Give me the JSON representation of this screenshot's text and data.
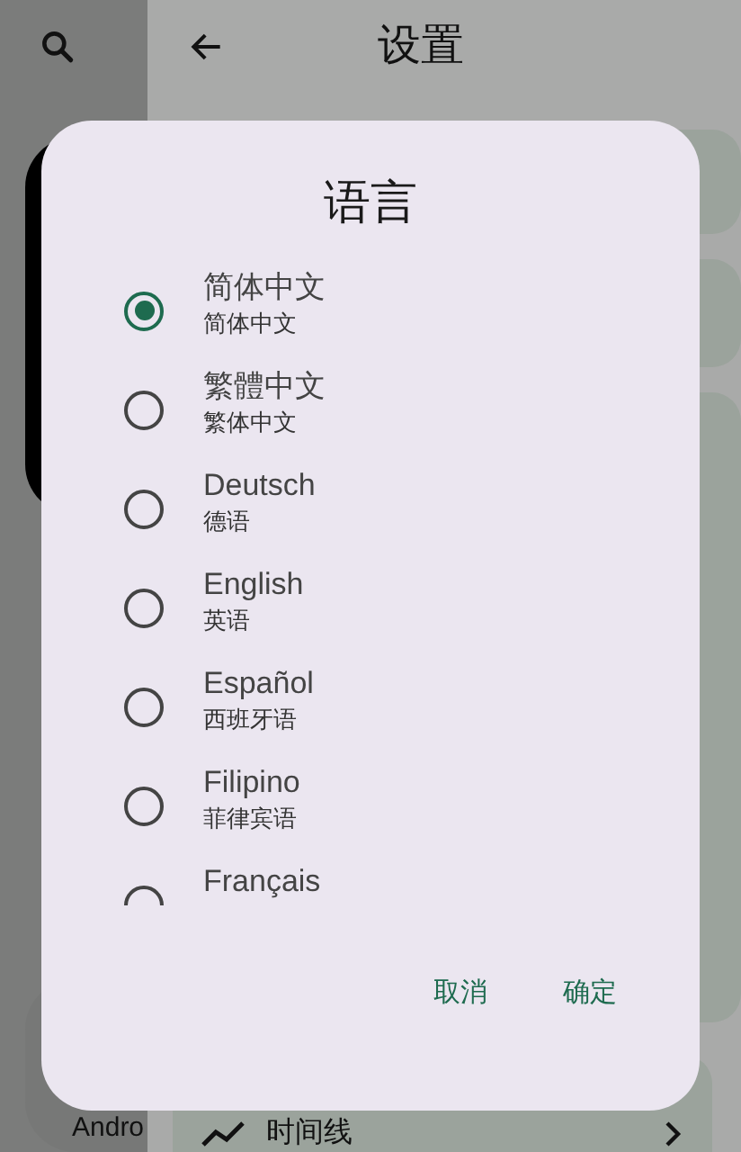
{
  "header": {
    "title": "设置"
  },
  "background": {
    "side_label": "Andro",
    "row_label": "时间线"
  },
  "dialog": {
    "title": "语言",
    "options": [
      {
        "label": "简体中文",
        "sub": "简体中文",
        "selected": true
      },
      {
        "label": "繁體中文",
        "sub": "繁体中文",
        "selected": false
      },
      {
        "label": "Deutsch",
        "sub": "德语",
        "selected": false
      },
      {
        "label": "English",
        "sub": "英语",
        "selected": false
      },
      {
        "label": "Español",
        "sub": "西班牙语",
        "selected": false
      },
      {
        "label": "Filipino",
        "sub": "菲律宾语",
        "selected": false
      },
      {
        "label": "Français",
        "selected": false
      }
    ],
    "buttons": [
      "取消",
      "确定"
    ]
  }
}
